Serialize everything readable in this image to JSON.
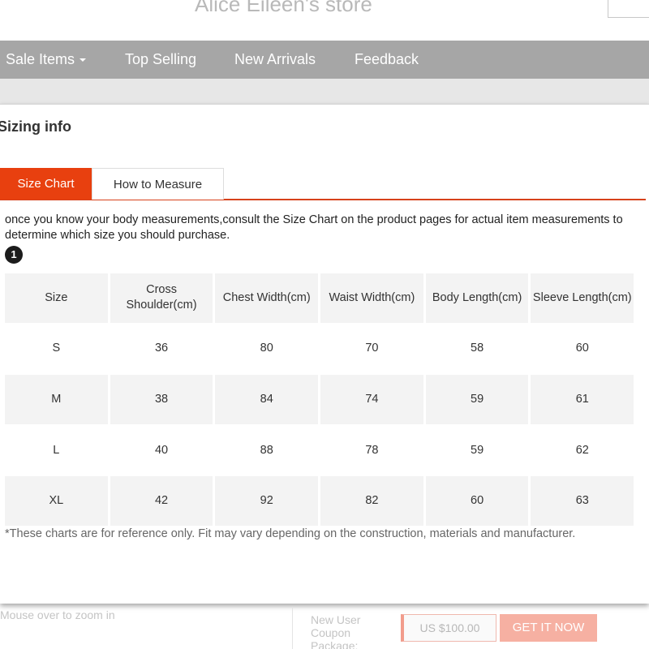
{
  "header": {
    "store_title": "Alice Eileen's store"
  },
  "nav": {
    "items": [
      {
        "label": "Sale Items",
        "has_dropdown": true
      },
      {
        "label": "Top Selling",
        "has_dropdown": false
      },
      {
        "label": "New Arrivals",
        "has_dropdown": false
      },
      {
        "label": "Feedback",
        "has_dropdown": false
      }
    ]
  },
  "modal": {
    "title": "Sizing info",
    "tabs": [
      {
        "label": "Size Chart",
        "active": true
      },
      {
        "label": "How to Measure",
        "active": false
      }
    ],
    "intro": "once you know your body measurements,consult the Size Chart on the product pages for actual item measurements to determine which size you should purchase.",
    "step_number": "1",
    "table": {
      "headers": [
        "Size",
        "Cross Shoulder(cm)",
        "Chest Width(cm)",
        "Waist Width(cm)",
        "Body Length(cm)",
        "Sleeve Length(cm)"
      ],
      "rows": [
        [
          "S",
          "36",
          "80",
          "70",
          "58",
          "60"
        ],
        [
          "M",
          "38",
          "84",
          "74",
          "59",
          "61"
        ],
        [
          "L",
          "40",
          "88",
          "78",
          "59",
          "62"
        ],
        [
          "XL",
          "42",
          "92",
          "82",
          "60",
          "63"
        ]
      ]
    },
    "note": "*These charts are for reference only. Fit may vary depending on the construction, materials and manufacturer."
  },
  "footer": {
    "zoom_hint": "Mouse over to zoom in",
    "coupon_label": "New User Coupon Package:",
    "coupon_value": "US $100.00",
    "cta_label": "GET IT NOW"
  },
  "colors": {
    "accent": "#e8400f",
    "nav_bg": "#a6a6a6",
    "row_shade": "#f3f3f3"
  }
}
